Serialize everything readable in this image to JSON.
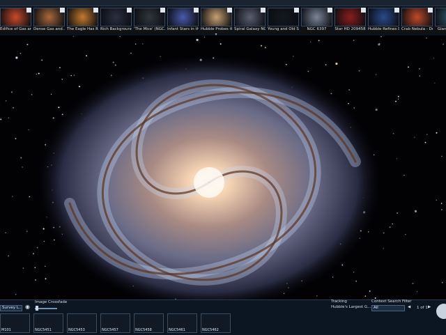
{
  "thumbnails": [
    {
      "label": "Edifice of Gas an...",
      "color": "#c84a2a"
    },
    {
      "label": "Dense Gas and...",
      "color": "#a86a3a"
    },
    {
      "label": "The Eagle Has Ri...",
      "color": "#c37a2c"
    },
    {
      "label": "Rich Background...",
      "color": "#2a3040"
    },
    {
      "label": "'The Mice' (NGC...",
      "color": "#30363e"
    },
    {
      "label": "Infant Stars in the...",
      "color": "#4a5aa8"
    },
    {
      "label": "Hubble Probes th...",
      "color": "#c8a070"
    },
    {
      "label": "Spiral Galaxy NG...",
      "color": "#5a6070"
    },
    {
      "label": "Young and Old St...",
      "color": "#141820"
    },
    {
      "label": "NGC 6397",
      "color": "#7c8698"
    },
    {
      "label": "Star HD 209458",
      "color": "#8a1e1e"
    },
    {
      "label": "Hubble Refines D...",
      "color": "#2a4a8a"
    },
    {
      "label": "Crab Nebula - De...",
      "color": "#c04a2a"
    },
    {
      "label": "Giant Galac...",
      "color": "#305a6a"
    }
  ],
  "bottom": {
    "survey_label": "Survey L...",
    "crossfade_label": "Image Crossfade",
    "crossfade_value": 0.1,
    "tracking_label": "Tracking",
    "tracking_value": "Hubble's Largest G...",
    "search_label": "Context Search Filter",
    "search_value": "All",
    "page_info": "1 of 1"
  },
  "context_thumbs": [
    {
      "label": "M101"
    },
    {
      "label": "NGC5451"
    },
    {
      "label": "NGC5453"
    },
    {
      "label": "NGC5457"
    },
    {
      "label": "NGC5458"
    },
    {
      "label": "NGC5461"
    },
    {
      "label": "NGC5462"
    }
  ]
}
